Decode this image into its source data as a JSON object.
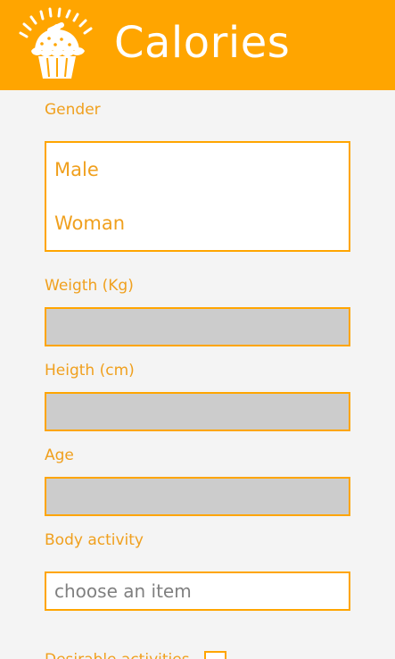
{
  "colors": {
    "accent": "#ffa500",
    "text_accent": "#f0a01e",
    "background": "#f4f4f4",
    "field_fill": "#cccccc",
    "placeholder": "#808080"
  },
  "header": {
    "title": "Calories",
    "logo_icon": "cupcake-gauge-icon"
  },
  "form": {
    "gender": {
      "label": "Gender",
      "options": [
        "Male",
        "Woman"
      ]
    },
    "weight": {
      "label": "Weigth (Kg)",
      "value": ""
    },
    "height": {
      "label": "Heigth (cm)",
      "value": ""
    },
    "age": {
      "label": "Age",
      "value": ""
    },
    "body_activity": {
      "label": "Body activity",
      "selected_text": "choose an item"
    },
    "desirable_activities": {
      "label": "Desirable activities",
      "checked": false
    }
  }
}
